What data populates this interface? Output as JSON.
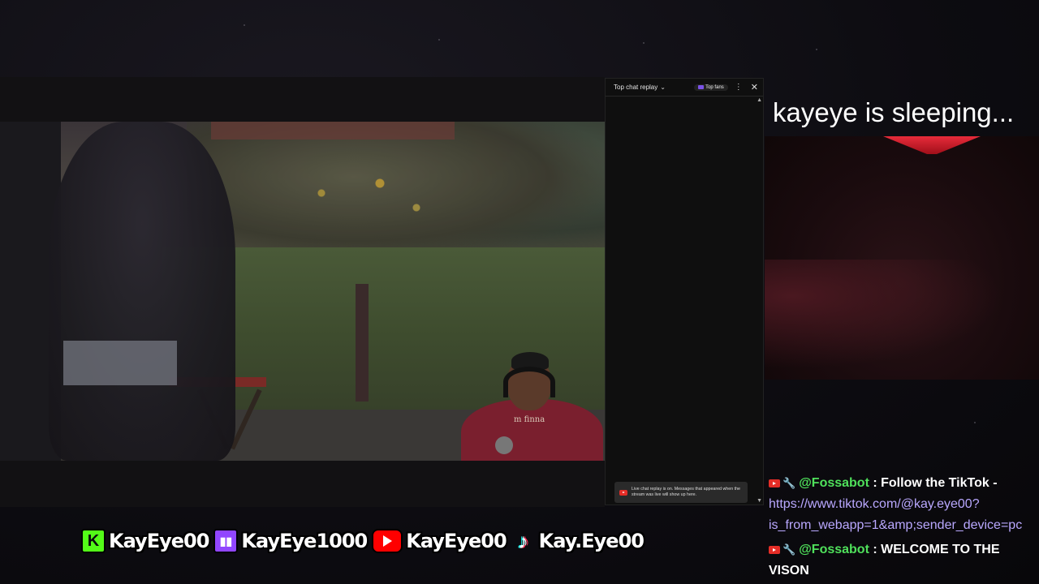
{
  "chat_panel": {
    "title": "Top chat replay",
    "top_fans_label": "Top fans",
    "notice": "Live chat replay is on. Messages that appeared when the stream was live will show up here."
  },
  "overlay": {
    "status_text": "kayeye is sleeping..."
  },
  "webcam": {
    "hoodie_text": "m finna"
  },
  "chat_messages": [
    {
      "author": "@Fossabot",
      "separator": " : ",
      "text": "Follow the TikTok - ",
      "link": "https://www.tiktok.com/@kay.eye00?is_from_webapp=1&amp;sender_device=pc"
    },
    {
      "author": "@Fossabot",
      "separator": " : ",
      "text": "WELCOME TO THE VISON",
      "link": ""
    }
  ],
  "socials": [
    {
      "platform": "kick",
      "icon": "kick-icon",
      "handle": "KayEye00",
      "color": "#53fc18"
    },
    {
      "platform": "twitch",
      "icon": "twitch-icon",
      "handle": "KayEye1000",
      "color": "#9146ff"
    },
    {
      "platform": "youtube",
      "icon": "youtube-icon",
      "handle": "KayEye00",
      "color": "#ff0000"
    },
    {
      "platform": "tiktok",
      "icon": "tiktok-icon",
      "handle": "Kay.Eye00",
      "color": "#25f4ee"
    }
  ],
  "colors": {
    "chat_author": "#4fe05b",
    "chat_link": "#b9a8ff",
    "neon": "#ff3040"
  }
}
